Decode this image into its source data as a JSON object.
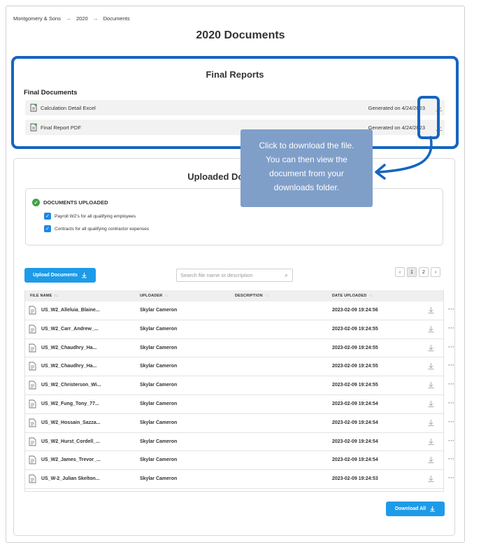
{
  "breadcrumb": {
    "items": [
      "Montgomery & Sons",
      "2020",
      "Documents"
    ],
    "separator": "→"
  },
  "page_title": "2020 Documents",
  "final_reports": {
    "title": "Final Reports",
    "subtitle": "Final Documents",
    "rows": [
      {
        "name": "Calculation Detail Excel",
        "generated": "Generated on 4/24/2023"
      },
      {
        "name": "Final Report PDF",
        "generated": "Generated on 4/24/2023"
      }
    ]
  },
  "tooltip": {
    "lines": [
      "Click to download the file.",
      "You can then view the",
      "document from your",
      "downloads folder."
    ]
  },
  "uploaded": {
    "title": "Uploaded Documents",
    "status_header": "DOCUMENTS UPLOADED",
    "checks": [
      "Payroll W2's for all qualifying employees",
      "Contracts for all qualifying contractor expenses"
    ],
    "upload_button": "Upload Documents",
    "search_placeholder": "Search file name or description",
    "pages": [
      "1",
      "2"
    ],
    "current_page": "1",
    "columns": {
      "file_name": "FILE NAME",
      "uploader": "UPLOADER",
      "description": "DESCRIPTION",
      "date": "DATE UPLOADED"
    },
    "rows": [
      {
        "file": "US_W2_Alleluia_Blaine...",
        "uploader": "Skylar Cameron",
        "date": "2023-02-09 19:24:56"
      },
      {
        "file": "US_W2_Carr_Andrew_...",
        "uploader": "Skylar Cameron",
        "date": "2023-02-09 19:24:55"
      },
      {
        "file": "US_W2_Chaudhry_Ha...",
        "uploader": "Skylar Cameron",
        "date": "2023-02-09 19:24:55"
      },
      {
        "file": "US_W2_Chaudhry_Ha...",
        "uploader": "Skylar Cameron",
        "date": "2023-02-09 19:24:55"
      },
      {
        "file": "US_W2_Christerson_Wi...",
        "uploader": "Skylar Cameron",
        "date": "2023-02-09 19:24:55"
      },
      {
        "file": "US_W2_Fung_Tony_77...",
        "uploader": "Skylar Cameron",
        "date": "2023-02-09 19:24:54"
      },
      {
        "file": "US_W2_Hossain_Sazza...",
        "uploader": "Skylar Cameron",
        "date": "2023-02-09 19:24:54"
      },
      {
        "file": "US_W2_Hurst_Cordell_...",
        "uploader": "Skylar Cameron",
        "date": "2023-02-09 19:24:54"
      },
      {
        "file": "US_W2_James_Trevor_...",
        "uploader": "Skylar Cameron",
        "date": "2023-02-09 19:24:54"
      },
      {
        "file": "US_W-2_Julian Skelton...",
        "uploader": "Skylar Cameron",
        "date": "2023-02-09 19:24:53"
      }
    ],
    "download_all_button": "Download All"
  },
  "colors": {
    "accent_blue": "#1565c0",
    "button_blue": "#1e9be8",
    "success_green": "#43a047",
    "tooltip_bg": "#7f9fc9"
  },
  "icons": [
    "download-icon",
    "document-icon",
    "more-icon",
    "search-icon",
    "chevron-left-icon",
    "chevron-right-icon",
    "check-icon",
    "sort-icon"
  ]
}
